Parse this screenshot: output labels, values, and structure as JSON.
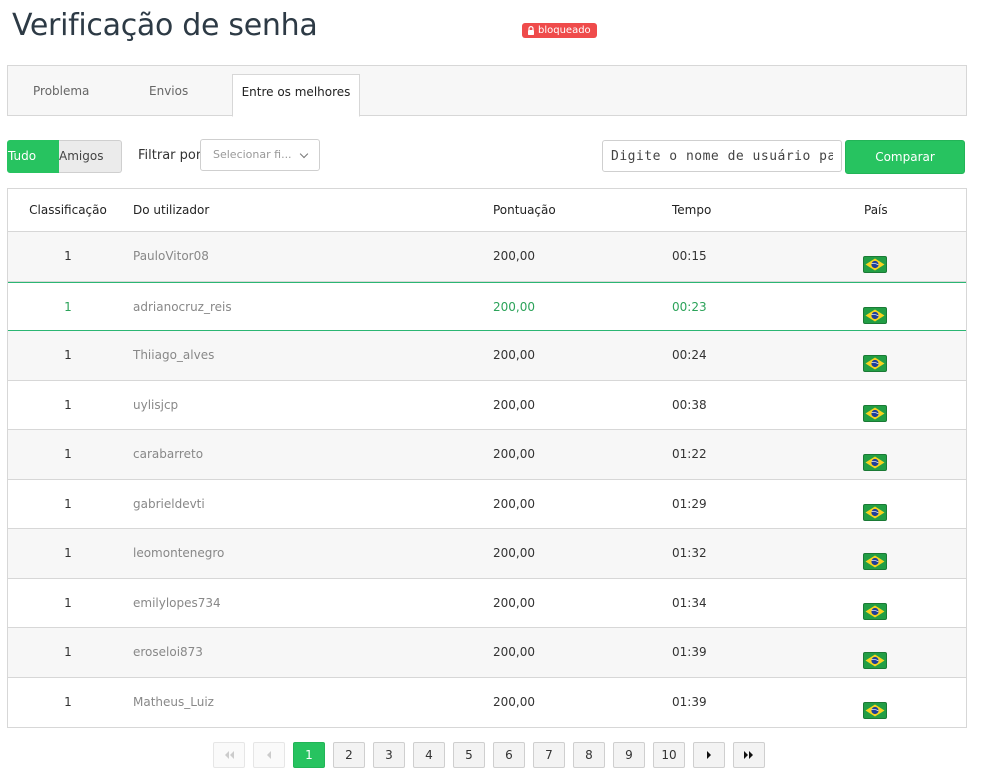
{
  "page": {
    "title": "Verificação de senha",
    "status_badge": "bloqueado",
    "accent_color": "#27c360",
    "badge_color": "#ef4b4b"
  },
  "tabs": [
    {
      "label": "Problema",
      "active": false
    },
    {
      "label": "Envios",
      "active": false
    },
    {
      "label": "Entre os melhores",
      "active": true
    }
  ],
  "filters": {
    "segment": [
      {
        "label": "Tudo",
        "active": true
      },
      {
        "label": "Amigos",
        "active": false
      }
    ],
    "filter_label": "Filtrar por",
    "filter_placeholder": "Selecionar fi...",
    "search_placeholder": "Digite o nome de usuário para",
    "compare_label": "Comparar"
  },
  "table": {
    "columns": [
      "Classificação",
      "Do utilizador",
      "Pontuação",
      "Tempo",
      "País"
    ],
    "rows": [
      {
        "rank": "1",
        "user": "PauloVitor08",
        "score": "200,00",
        "time": "00:15",
        "country": "brazil-flag-icon"
      },
      {
        "rank": "1",
        "user": "adrianocruz_reis",
        "score": "200,00",
        "time": "00:23",
        "country": "brazil-flag-icon",
        "highlighted": true
      },
      {
        "rank": "1",
        "user": "Thiiago_alves",
        "score": "200,00",
        "time": "00:24",
        "country": "brazil-flag-icon"
      },
      {
        "rank": "1",
        "user": "uylisjcp",
        "score": "200,00",
        "time": "00:38",
        "country": "brazil-flag-icon"
      },
      {
        "rank": "1",
        "user": "carabarreto",
        "score": "200,00",
        "time": "01:22",
        "country": "brazil-flag-icon"
      },
      {
        "rank": "1",
        "user": "gabrieldevti",
        "score": "200,00",
        "time": "01:29",
        "country": "brazil-flag-icon"
      },
      {
        "rank": "1",
        "user": "leomontenegro",
        "score": "200,00",
        "time": "01:32",
        "country": "brazil-flag-icon"
      },
      {
        "rank": "1",
        "user": "emilylopes734",
        "score": "200,00",
        "time": "01:34",
        "country": "brazil-flag-icon"
      },
      {
        "rank": "1",
        "user": "eroseloi873",
        "score": "200,00",
        "time": "01:39",
        "country": "brazil-flag-icon"
      },
      {
        "rank": "1",
        "user": "Matheus_Luiz",
        "score": "200,00",
        "time": "01:39",
        "country": "brazil-flag-icon"
      }
    ]
  },
  "pagination": {
    "pages": [
      "1",
      "2",
      "3",
      "4",
      "5",
      "6",
      "7",
      "8",
      "9",
      "10"
    ],
    "current": "1",
    "icons": [
      "first-page-icon",
      "prev-page-icon",
      "next-page-icon",
      "last-page-icon"
    ]
  }
}
